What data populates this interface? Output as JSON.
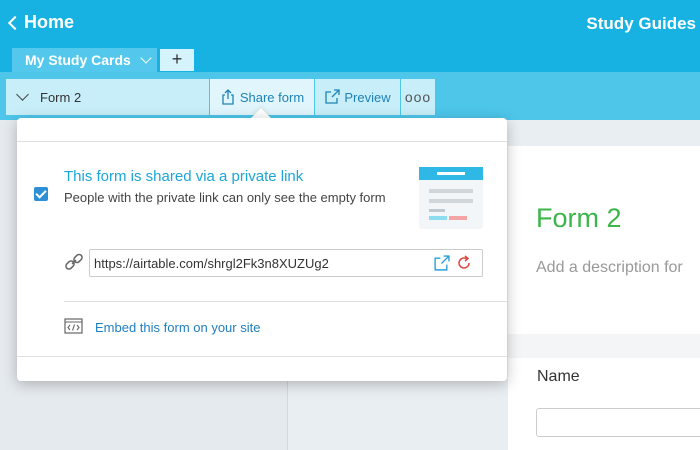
{
  "header": {
    "back_label": "Home",
    "app_title": "Study Guides"
  },
  "tabs": {
    "active_label": "My Study Cards",
    "add_label": "+"
  },
  "viewbar": {
    "view_name": "Form 2",
    "share_label": "Share form",
    "preview_label": "Preview",
    "more_label": "ooo"
  },
  "popover": {
    "shared_title": "This form is shared via a private link",
    "shared_desc": "People with the private link can only see the empty form",
    "checkbox_checked": true,
    "url": "https://airtable.com/shrgl2Fk3n8XUZUg2",
    "embed_label": "Embed this form on your site"
  },
  "form_preview": {
    "title": "Form 2",
    "description_placeholder": "Add a description for",
    "field_label": "Name"
  },
  "icons": {
    "back": "chevron-left-icon",
    "dropdown": "chevron-down-icon",
    "share": "share-icon",
    "preview": "external-link-icon",
    "link": "link-icon",
    "open": "open-external-icon",
    "regenerate": "refresh-icon",
    "embed": "code-embed-icon"
  },
  "colors": {
    "brand_blue": "#17b1e2",
    "link_blue": "#1f7fc0",
    "accent_green": "#3cb54a",
    "regen_red": "#e0463e"
  }
}
